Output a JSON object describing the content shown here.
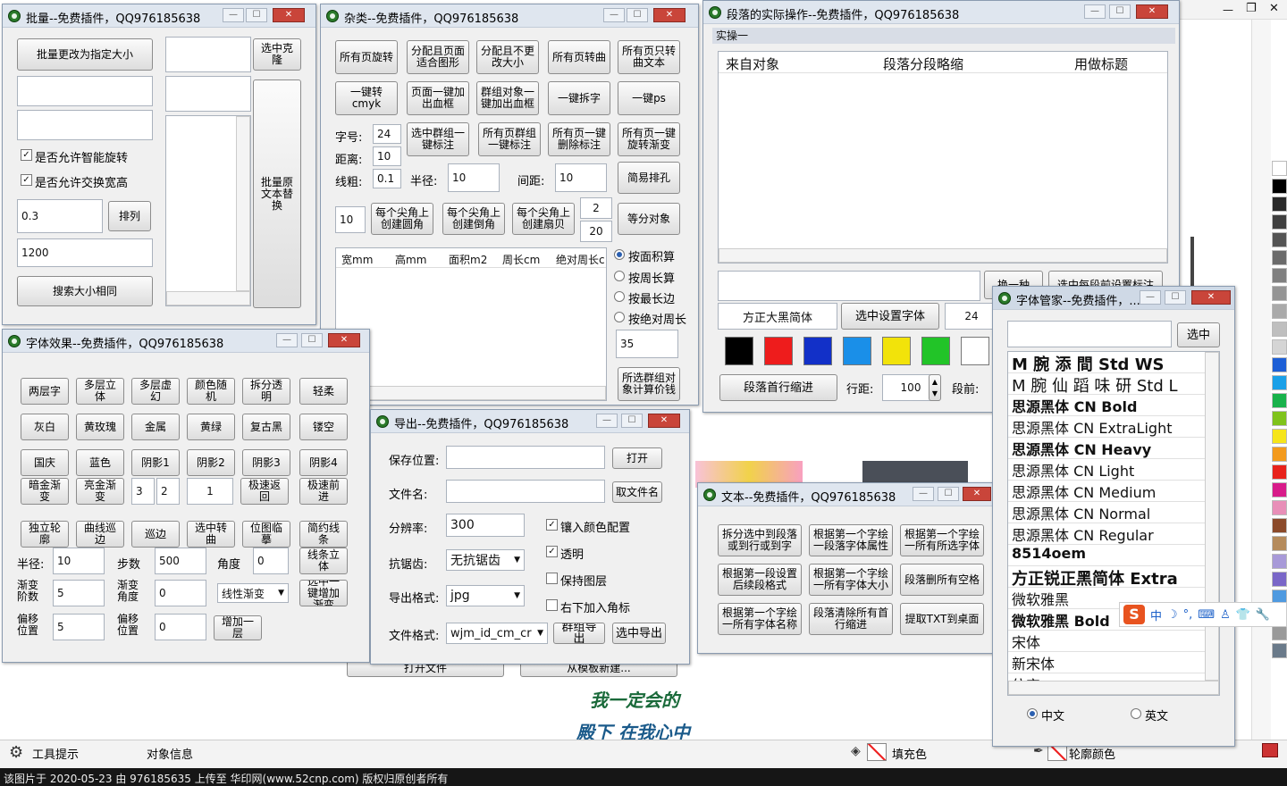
{
  "batch": {
    "title": "批量--免费插件，QQ976185638",
    "btn_resize": "批量更改为指定大小",
    "btn_select_clone": "选中克隆",
    "chk_rotate": "是否允许智能旋转",
    "chk_swap": "是否允许交换宽高",
    "val_ratio": "0.3",
    "btn_arrange": "排列",
    "val_size": "1200",
    "btn_search_size": "搜索大小相同",
    "btn_replace_text": "批量原文本替换"
  },
  "misc": {
    "title": "杂类--免费插件，QQ976185638",
    "row1": [
      "所有页旋转",
      "分配且页面适合图形",
      "分配且不更改大小",
      "所有页转曲",
      "所有页只转曲文本"
    ],
    "row2": [
      "一键转cmyk",
      "页面一键加出血框",
      "群组对象一键加出血框",
      "一键拆字",
      "一键ps"
    ],
    "lbl_font": "字号:",
    "val_font": "24",
    "lbl_dist": "距离:",
    "val_dist": "10",
    "lbl_weight": "线粗:",
    "val_weight": "0.1",
    "row3": [
      "选中群组一键标注",
      "所有页群组一键标注",
      "所有页一键删除标注",
      "所有页一键旋转渐变"
    ],
    "lbl_radius": "半径:",
    "val_radius": "10",
    "lbl_gap": "间距:",
    "val_gap": "10",
    "btn_holes": "简易排孔",
    "val_corner": "10",
    "row4": [
      "每个尖角上创建圆角",
      "每个尖角上创建倒角",
      "每个尖角上创建扇贝"
    ],
    "val_a": "2",
    "val_b": "20",
    "btn_divide": "等分对象",
    "cols": [
      "宽mm",
      "高mm",
      "面积m2",
      "周长cm",
      "绝对周长c"
    ],
    "radios": [
      "按面积算",
      "按周长算",
      "按最长边",
      "按绝对周长"
    ],
    "val_35": "35",
    "btn_price": "所选群组对象计算价钱"
  },
  "para": {
    "title": "段落的实际操作--免费插件，QQ976185638",
    "tab": "实操一",
    "cols": [
      "来自对象",
      "段落分段略缩",
      "用做标题"
    ],
    "btn_swap": "换一种",
    "btn_set": "选中每段前设置标注",
    "font_name": "方正大黑简体",
    "btn_set_font": "选中设置字体",
    "font_size": "24",
    "btn_indent": "段落首行缩进",
    "lbl_line": "行距:",
    "val_line": "100",
    "lbl_before": "段前:",
    "colors": [
      "#000000",
      "#ee1c1c",
      "#1230c8",
      "#1a8fe8",
      "#f2e30a",
      "#22c428",
      "#ffffff"
    ]
  },
  "fx": {
    "title": "字体效果--免费插件，QQ976185638",
    "row1": [
      "两层字",
      "多层立体",
      "多层虚幻",
      "颜色随机",
      "拆分透明",
      "轻柔"
    ],
    "row2": [
      "灰白",
      "黄玫瑰",
      "金属",
      "黄绿",
      "复古黑",
      "镂空"
    ],
    "row3": [
      "国庆",
      "蓝色",
      "阴影1",
      "阴影2",
      "阴影3",
      "阴影4"
    ],
    "btn_dark_gold": "暗金渐变",
    "btn_bright_gold": "亮金渐变",
    "v3": "3",
    "v2": "2",
    "v1": "1",
    "btn_fast_back": "极速返回",
    "btn_fast_fwd": "极速前进",
    "row5": [
      "独立轮廓",
      "曲线巡边",
      "巡边",
      "选中转曲",
      "位图临摹",
      "简约线条"
    ],
    "lbl_radius": "半径:",
    "val_radius": "10",
    "lbl_step": "步数",
    "val_step": "500",
    "lbl_angle": "角度",
    "val_angle": "0",
    "btn_line3d": "线条立体",
    "lbl_grad_step": "渐变阶数",
    "val_grad_step": "5",
    "lbl_grad_angle": "渐变角度",
    "val_grad_angle": "0",
    "sel_grad": "线性渐变",
    "btn_add_grad": "选中一键增加渐变",
    "lbl_offset": "偏移位置",
    "val_offset1": "5",
    "lbl_offset2": "偏移位置",
    "val_offset2": "0",
    "btn_add_layer": "增加一层"
  },
  "export": {
    "title": "导出--免费插件，QQ976185638",
    "lbl_path": "保存位置:",
    "btn_open": "打开",
    "lbl_name": "文件名:",
    "btn_take_name": "取文件名",
    "lbl_res": "分辨率:",
    "val_res": "300",
    "chk_color": "镶入颜色配置",
    "chk_trans": "透明",
    "lbl_aa": "抗锯齿:",
    "sel_aa": "无抗锯齿",
    "chk_layers": "保持图层",
    "lbl_fmt": "导出格式:",
    "sel_fmt": "jpg",
    "chk_corner": "右下加入角标",
    "lbl_ftype": "文件格式:",
    "sel_ftype": "wjm_id_cm_cr",
    "btn_group_export": "群组导出",
    "btn_export_sel": "选中导出"
  },
  "text": {
    "title": "文本--免费插件，QQ976185638",
    "btns": [
      "拆分选中到段落或到行或到字",
      "根据第一个字绘一段落字体属性",
      "根据第一个字绘一所有所选字体",
      "根据第一段设置后续段格式",
      "根据第一个字绘一所有字体大小",
      "段落删所有空格",
      "根据第一个字绘一所有字体名称",
      "段落清除所有首行缩进",
      "提取TXT到桌面"
    ]
  },
  "fontmgr": {
    "title": "字体管家--免费插件，...",
    "btn_select": "选中",
    "fonts": [
      "M 腕 添   間 Std WS",
      "M 腕 仙 蹈 味 研 Std L",
      "思源黑体 CN Bold",
      "思源黑体 CN ExtraLight",
      "思源黑体 CN Heavy",
      "思源黑体 CN Light",
      "思源黑体 CN Medium",
      "思源黑体 CN Normal",
      "思源黑体 CN Regular",
      "8514oem",
      "方正锐正黑简体 Extra",
      "微软雅黑",
      "微软雅黑 Bold",
      "宋体",
      "新宋体",
      "仿宋"
    ],
    "radio_cn": "中文",
    "radio_en": "英文"
  },
  "canvas": {
    "text_line1": "我一定会的",
    "text_line2": "殿下 在我心中",
    "btn_open_file": "打开文件",
    "btn_new_template": "从模板新建..."
  },
  "bottom": {
    "tool_tips": "工具提示",
    "obj_info": "对象信息",
    "fill_label": "填充色",
    "outline_label": "轮廓颜色",
    "footer": "该图片于 2020-05-23 由 976185635 上传至 华印网(www.52cnp.com) 版权归原创者所有"
  },
  "ime": {
    "logo": "S",
    "lang": "中"
  },
  "palette": [
    "#ffffff",
    "#000000",
    "#2a2a2a",
    "#404040",
    "#555555",
    "#6b6b6b",
    "#808080",
    "#959595",
    "#aaaaaa",
    "#bfbfbf",
    "#d5d5d5",
    "#1d5fd6",
    "#1aa0e8",
    "#19b24b",
    "#7fc31c",
    "#f6e51a",
    "#f39a1c",
    "#e8231c",
    "#d81c8a",
    "#e88fb8",
    "#8b4a2a",
    "#b58b5c",
    "#a89ad8",
    "#7a67c8",
    "#4f9ae0",
    "#c6c6e8",
    "#9a9a9a",
    "#6a7a8a"
  ]
}
